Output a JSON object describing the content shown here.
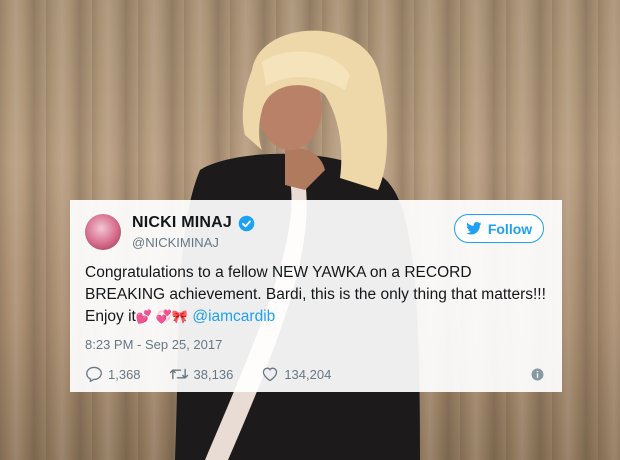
{
  "tweet": {
    "name": "NICKI MINAJ",
    "handle": "@NICKIMINAJ",
    "follow_label": "Follow",
    "text": "Congratulations to a fellow NEW YAWKA on a RECORD BREAKING achievement. Bardi, this is the only thing that matters!!! Enjoy it",
    "emojis": "💕 💞🎀",
    "mention": "@iamcardib",
    "timestamp": "8:23 PM - Sep 25, 2017",
    "replies": "1,368",
    "retweets": "38,136",
    "likes": "134,204"
  },
  "icons": {
    "verified": "verified-badge-icon",
    "bird": "twitter-bird-icon",
    "reply": "reply-icon",
    "retweet": "retweet-icon",
    "like": "heart-icon",
    "info": "info-icon"
  },
  "colors": {
    "accent": "#1da1f2",
    "text": "#14171a",
    "muted": "#657786"
  }
}
